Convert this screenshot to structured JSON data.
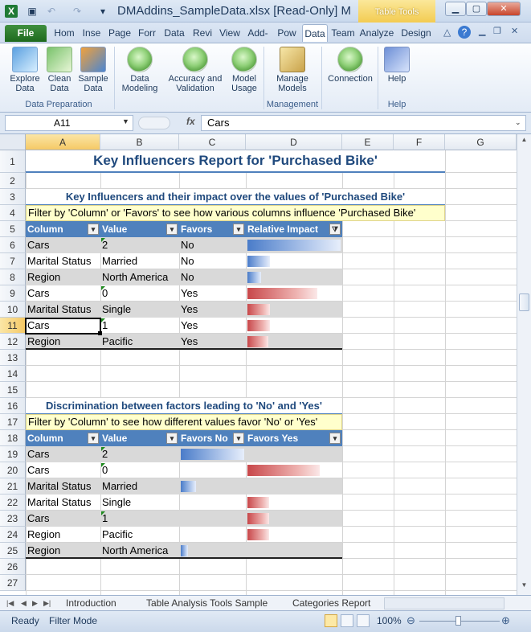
{
  "window": {
    "title": "DMAddins_SampleData.xlsx  [Read-Only] M",
    "context_tab": "Table Tools"
  },
  "ribbon_tabs": [
    "Hom",
    "Inse",
    "Page",
    "Forr",
    "Data",
    "Revi",
    "View",
    "Add-",
    "Pow",
    "Data",
    "Team",
    "Analyze",
    "Design"
  ],
  "file_tab": "File",
  "ribbon": {
    "explore": "Explore\nData",
    "clean": "Clean\nData",
    "sample": "Sample\nData",
    "data_modeling": "Data\nModeling",
    "accuracy": "Accuracy and\nValidation",
    "model_usage": "Model\nUsage",
    "manage": "Manage\nModels",
    "connection": "Connection",
    "help": "Help",
    "grp_prep": "Data Preparation",
    "grp_mgmt": "Management",
    "grp_help": "Help"
  },
  "formula_bar": {
    "name_box": "A11",
    "fx": "fx",
    "formula": "Cars"
  },
  "columns": [
    "A",
    "B",
    "C",
    "D",
    "E",
    "F",
    "G"
  ],
  "rows": [
    "1",
    "2",
    "3",
    "4",
    "5",
    "6",
    "7",
    "8",
    "9",
    "10",
    "11",
    "12",
    "13",
    "14",
    "15",
    "16",
    "17",
    "18",
    "19",
    "20",
    "21",
    "22",
    "23",
    "24",
    "25",
    "26",
    "27"
  ],
  "report": {
    "title": "Key Influencers Report for 'Purchased Bike'",
    "sub1": "Key Influencers and their impact over the values of 'Purchased Bike'",
    "hint1": "Filter by 'Column' or 'Favors' to see how various columns influence 'Purchased Bike'",
    "t1_headers": [
      "Column",
      "Value",
      "Favors",
      "Relative Impact"
    ],
    "t1_rows": [
      {
        "column": "Cars",
        "value": "2",
        "favors": "No",
        "impact": 1.0
      },
      {
        "column": "Marital Status",
        "value": "Married",
        "favors": "No",
        "impact": 0.24
      },
      {
        "column": "Region",
        "value": "North America",
        "favors": "No",
        "impact": 0.15
      },
      {
        "column": "Cars",
        "value": "0",
        "favors": "Yes",
        "impact": 0.75
      },
      {
        "column": "Marital Status",
        "value": "Single",
        "favors": "Yes",
        "impact": 0.24
      },
      {
        "column": "Cars",
        "value": "1",
        "favors": "Yes",
        "impact": 0.24
      },
      {
        "column": "Region",
        "value": "Pacific",
        "favors": "Yes",
        "impact": 0.22
      }
    ],
    "sub2": "Discrimination between factors leading to 'No' and 'Yes'",
    "hint2": "Filter by 'Column' to see how different values favor 'No' or 'Yes'",
    "t2_headers": [
      "Column",
      "Value",
      "Favors No",
      "Favors Yes"
    ],
    "t2_rows": [
      {
        "column": "Cars",
        "value": "2",
        "no": 1.0,
        "yes": 0
      },
      {
        "column": "Cars",
        "value": "0",
        "no": 0,
        "yes": 1.0
      },
      {
        "column": "Marital Status",
        "value": "Married",
        "no": 0.24,
        "yes": 0
      },
      {
        "column": "Marital Status",
        "value": "Single",
        "no": 0,
        "yes": 0.3
      },
      {
        "column": "Cars",
        "value": "1",
        "no": 0,
        "yes": 0.3
      },
      {
        "column": "Region",
        "value": "Pacific",
        "no": 0,
        "yes": 0.3
      },
      {
        "column": "Region",
        "value": "North America",
        "no": 0.12,
        "yes": 0
      }
    ]
  },
  "sheet_tabs": [
    "Introduction",
    "Table Analysis Tools Sample",
    "Categories Report"
  ],
  "status": {
    "ready": "Ready",
    "mode": "Filter Mode",
    "zoom": "100%"
  }
}
